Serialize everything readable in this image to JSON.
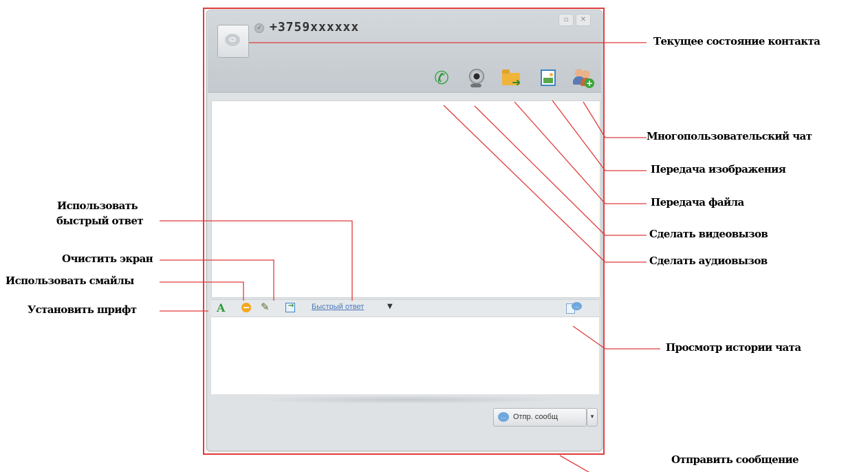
{
  "window": {
    "contact_name": "+3759xxxxxx",
    "status_glyph": "✓",
    "window_buttons": {
      "restore": "▫",
      "close": "✕"
    },
    "toolbar_icons": [
      "phone-icon",
      "webcam-icon",
      "folder-send-icon",
      "image-send-icon",
      "multi-user-icon"
    ],
    "format_bar": {
      "font_glyph": "A",
      "broom_glyph": "✎",
      "quick_reply_label": "Быстрый ответ",
      "caret": "▼",
      "history_glyph": "…"
    },
    "send_button_label": "Отпр. сообщ",
    "send_dropdown": "▾"
  },
  "annotations": {
    "contact_status": "Текущее состояние контакта",
    "multi_user_chat": "Многопользовательский чат",
    "image_transfer": "Передача изображения",
    "file_transfer": "Передача файла",
    "video_call": "Сделать видеовызов",
    "audio_call": "Сделать аудиовызов",
    "quick_reply_line1": "Использовать",
    "quick_reply_line2": "быстрый ответ",
    "clear_screen": "Очистить экран",
    "use_smileys": "Использовать смайлы",
    "set_font": "Установить шрифт",
    "chat_history": "Просмотр истории чата",
    "send_message": "Отправить сообщение"
  },
  "colors": {
    "annotation_line": "#e03a3a",
    "link": "#4a78b8",
    "phone": "#2e9a3a"
  }
}
